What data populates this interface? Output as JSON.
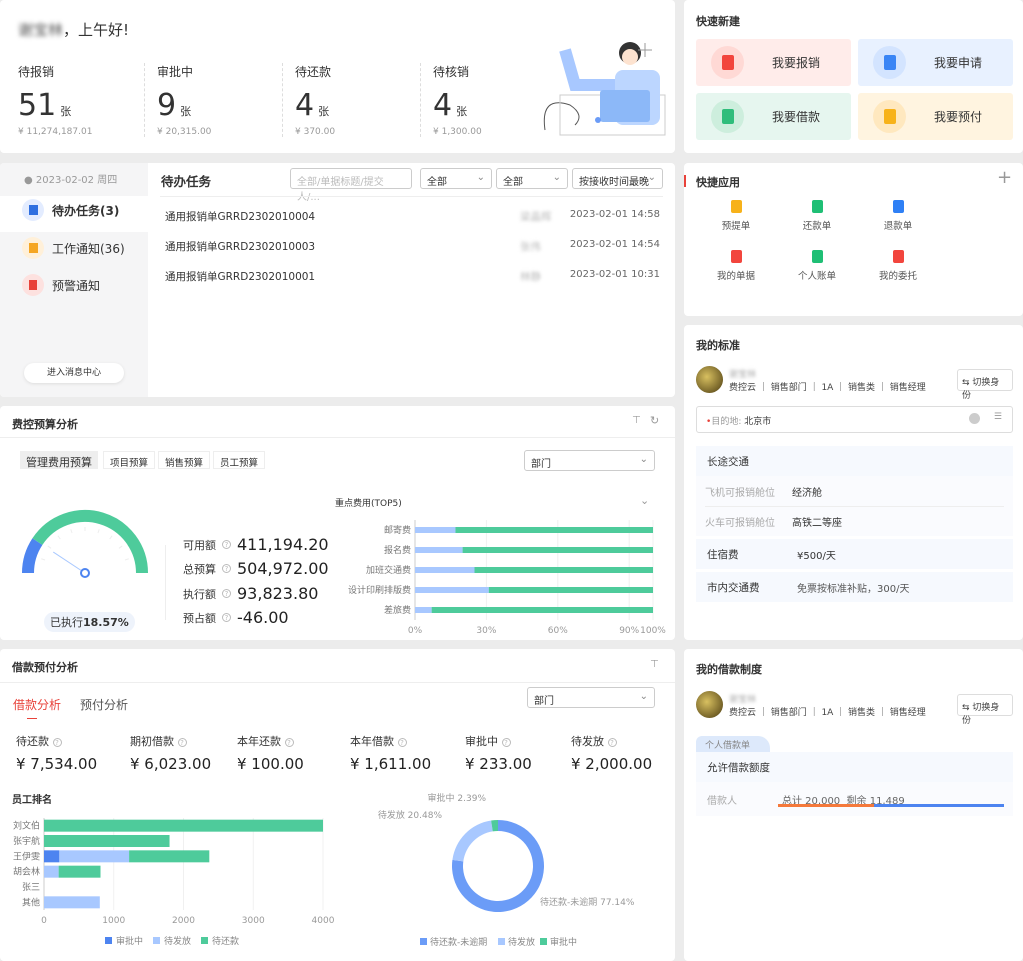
{
  "greeting": {
    "name": "谢宝林",
    "text": "，上午好!"
  },
  "stats": [
    {
      "label": "待报销",
      "count": "51",
      "unit": "张",
      "amount": "¥ 11,274,187.01"
    },
    {
      "label": "审批中",
      "count": "9",
      "unit": "张",
      "amount": "¥ 20,315.00"
    },
    {
      "label": "待还款",
      "count": "4",
      "unit": "张",
      "amount": "¥ 370.00"
    },
    {
      "label": "待核销",
      "count": "4",
      "unit": "张",
      "amount": "¥ 1,300.00"
    }
  ],
  "messages": {
    "date": "2023-02-02 周四",
    "items": [
      {
        "label": "待办任务(3)",
        "color": "#2f6fe0"
      },
      {
        "label": "工作通知(36)",
        "color": "#f5a623"
      },
      {
        "label": "预警通知",
        "color": "#e8423a"
      }
    ],
    "center_button": "进入消息中心",
    "title": "待办任务",
    "search_placeholder": "全部/单据标题/提交人/...",
    "filter1": "全部",
    "filter2": "全部",
    "sort": "按接收时间最晚",
    "tasks": [
      {
        "title": "通用报销单GRRD2302010004",
        "submitter": "梁晶辉",
        "time": "2023-02-01 14:58"
      },
      {
        "title": "通用报销单GRRD2302010003",
        "submitter": "张伟",
        "time": "2023-02-01 14:54"
      },
      {
        "title": "通用报销单GRRD2302010001",
        "submitter": "林静",
        "time": "2023-02-01 10:31"
      }
    ]
  },
  "budget": {
    "title": "费控预算分析",
    "tabs": [
      "管理费用预算",
      "项目预算",
      "销售预算",
      "员工预算"
    ],
    "dimension": "部门",
    "executed_label": "已执行",
    "executed_pct": "18.57%",
    "gauge_value": 18.57,
    "kv": [
      {
        "label": "可用额",
        "value": "411,194.20"
      },
      {
        "label": "总预算",
        "value": "504,972.00"
      },
      {
        "label": "执行额",
        "value": "93,823.80"
      },
      {
        "label": "预占额",
        "value": "-46.00"
      }
    ],
    "top_title": "重点费用(TOP5)"
  },
  "loan": {
    "title": "借款预付分析",
    "tabs": [
      "借款分析",
      "预付分析"
    ],
    "dimension": "部门",
    "stats": [
      {
        "label": "待还款",
        "value": "¥ 7,534.00"
      },
      {
        "label": "期初借款",
        "value": "¥ 6,023.00"
      },
      {
        "label": "本年还款",
        "value": "¥ 100.00"
      },
      {
        "label": "本年借款",
        "value": "¥ 1,611.00"
      },
      {
        "label": "审批中",
        "value": "¥ 233.00"
      },
      {
        "label": "待发放",
        "value": "¥ 2,000.00"
      }
    ],
    "rank_title": "员工排名"
  },
  "chart_data": [
    {
      "type": "bar",
      "orientation": "horizontal",
      "stacked": true,
      "title": "重点费用(TOP5)",
      "categories": [
        "邮寄费",
        "报名费",
        "加班交通费",
        "设计印刷排版费",
        "差旅费"
      ],
      "xticks": [
        "0%",
        "30%",
        "60%",
        "90%",
        "100%"
      ],
      "xlim": [
        0,
        100
      ],
      "series": [
        {
          "values": [
            17,
            20,
            25,
            31,
            7
          ],
          "color": "#a8c8ff"
        },
        {
          "values": [
            83,
            80,
            75,
            69,
            93
          ],
          "color": "#4ecb9b"
        }
      ]
    },
    {
      "type": "bar",
      "orientation": "horizontal",
      "stacked": true,
      "categories": [
        "刘文伯",
        "张宇航",
        "王伊雯",
        "胡会林",
        "张三",
        "其他"
      ],
      "xticks": [
        "0",
        "1000",
        "2000",
        "3000",
        "4000"
      ],
      "xlim": [
        0,
        4000
      ],
      "series": [
        {
          "name": "审批中",
          "values": [
            0,
            0,
            220,
            0,
            0,
            0
          ],
          "color": "#4d84f0"
        },
        {
          "name": "待发放",
          "values": [
            0,
            0,
            1000,
            210,
            0,
            800
          ],
          "color": "#a8c8ff"
        },
        {
          "name": "待还款",
          "values": [
            4000,
            1800,
            1150,
            600,
            0,
            0
          ],
          "color": "#4ecb9b"
        }
      ],
      "legend": "bottom"
    },
    {
      "type": "pie",
      "donut": true,
      "slices": [
        {
          "name": "待还款-未逾期",
          "value": 77.14,
          "label": "待还款-未逾期 77.14%",
          "color": "#6b9cf7"
        },
        {
          "name": "待发放",
          "value": 20.48,
          "label": "待发放 20.48%",
          "color": "#a8c8ff"
        },
        {
          "name": "审批中",
          "value": 2.39,
          "label": "审批中 2.39%",
          "color": "#4ecb9b"
        }
      ],
      "legend": "bottom"
    }
  ],
  "quick_new": {
    "title": "快速新建",
    "items": [
      {
        "label": "我要报销",
        "bg": "#ffecea",
        "icon_bg": "#ffd9d5",
        "icon": "#f2453d"
      },
      {
        "label": "我要申请",
        "bg": "#e8f1ff",
        "icon_bg": "#d3e4ff",
        "icon": "#3a85f5"
      },
      {
        "label": "我要借款",
        "bg": "#e6f6ef",
        "icon_bg": "#cdeedd",
        "icon": "#2fbd7b"
      },
      {
        "label": "我要预付",
        "bg": "#fff4e0",
        "icon_bg": "#ffe8bf",
        "icon": "#f7b21a"
      }
    ]
  },
  "quick_apps": {
    "title": "快捷应用",
    "add": "+",
    "items": [
      {
        "label": "预提单",
        "color": "#f7b21a"
      },
      {
        "label": "还款单",
        "color": "#1fbf75"
      },
      {
        "label": "退款单",
        "color": "#2f80f5"
      },
      {
        "label": "我的单据",
        "color": "#f2453d"
      },
      {
        "label": "个人账单",
        "color": "#1fbf75"
      },
      {
        "label": "我的委托",
        "color": "#f2453d"
      }
    ]
  },
  "standard": {
    "title": "我的标准",
    "user": "谢宝林",
    "tags": "费控云 ｜ 销售部门 ｜ 1A ｜ 销售类 ｜ 销售经理",
    "switch": "⇆ 切换身份",
    "dest_label": "目的地:",
    "dest_value": "北京市",
    "long_title": "长途交通",
    "rows": [
      {
        "k": "飞机可报销舱位",
        "v": "经济舱"
      },
      {
        "k": "火车可报销舱位",
        "v": "高铁二等座"
      }
    ],
    "hotel": {
      "k": "住宿费",
      "v": "¥500/天"
    },
    "local": {
      "k": "市内交通费",
      "v": "免票按标准补贴，300/天"
    }
  },
  "loan_policy": {
    "title": "我的借款制度",
    "user": "谢宝林",
    "tags": "费控云 ｜ 销售部门 ｜ 1A ｜ 销售类 ｜ 销售经理",
    "switch": "⇆ 切换身份",
    "tab": "个人借款单",
    "allow": "允许借款额度",
    "borrower": "借款人",
    "total": "总计 20,000",
    "remain": "剩余 11,489",
    "used_fraction": 0.4256
  }
}
